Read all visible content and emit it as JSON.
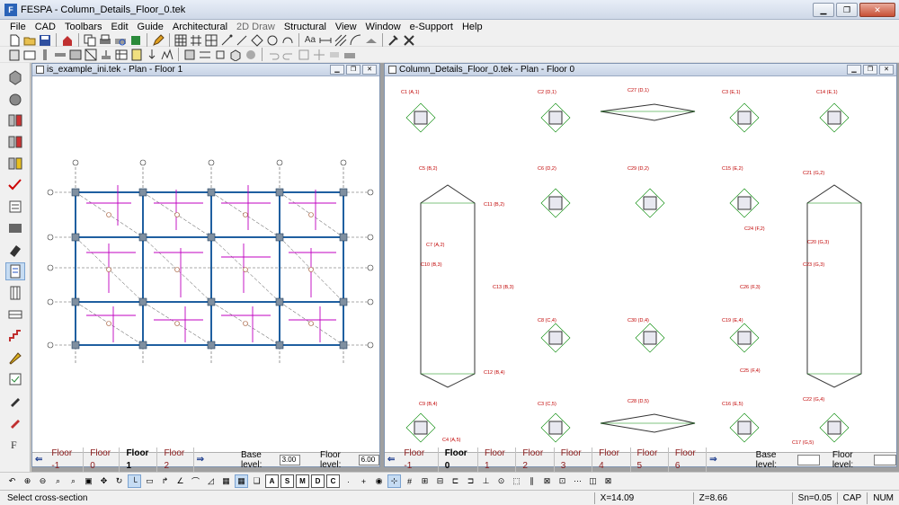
{
  "app": {
    "title": "FESPA - Column_Details_Floor_0.tek",
    "icon_label": "F"
  },
  "window_controls": [
    "minimize-icon",
    "maximize-icon",
    "close-icon"
  ],
  "menu": [
    {
      "label": "File",
      "enabled": true
    },
    {
      "label": "CAD",
      "enabled": true
    },
    {
      "label": "Toolbars",
      "enabled": true
    },
    {
      "label": "Edit",
      "enabled": true
    },
    {
      "label": "Guide",
      "enabled": true
    },
    {
      "label": "Architectural",
      "enabled": true
    },
    {
      "label": "2D Draw",
      "enabled": false
    },
    {
      "label": "Structural",
      "enabled": true
    },
    {
      "label": "View",
      "enabled": true
    },
    {
      "label": "Window",
      "enabled": true
    },
    {
      "label": "e-Support",
      "enabled": true
    },
    {
      "label": "Help",
      "enabled": true
    }
  ],
  "toolbar1": {
    "text_tool": "Aa"
  },
  "left_window": {
    "title": "is_example_ini.tek - Plan - Floor 1",
    "floors": [
      "Floor -1",
      "Floor 0",
      "Floor 1",
      "Floor 2"
    ],
    "active_floor": "Floor 1",
    "base_level_label": "Base level:",
    "base_level": "3.00",
    "floor_level_label": "Floor level:",
    "floor_level": "6.00"
  },
  "right_window": {
    "title": "Column_Details_Floor_0.tek - Plan - Floor 0",
    "floors": [
      "Floor -1",
      "Floor 0",
      "Floor 1",
      "Floor 2",
      "Floor 3",
      "Floor 4",
      "Floor 5",
      "Floor 6"
    ],
    "active_floor": "Floor 0",
    "base_level_label": "Base level:",
    "base_level": "",
    "floor_level_label": "Floor level:",
    "floor_level": "",
    "column_labels": [
      "C1 (A,1)",
      "C2 (D,1)",
      "C27 (D,1)",
      "C3 (E,1)",
      "C14 (E,1)",
      "C5 (B,2)",
      "C6 (D,2)",
      "C29 (D,2)",
      "C15 (E,2)",
      "C21 (G,2)",
      "C11 (B,2)",
      "C24 (F,2)",
      "C7 (A,2)",
      "C20 (G,3)",
      "C10 (B,3)",
      "C13 (B,3)",
      "C23 (G,3)",
      "C26 (F,3)",
      "C8 (C,4)",
      "C30 (D,4)",
      "C19 (E,4)",
      "C12 (B,4)",
      "C25 (F,4)",
      "C9 (B,4)",
      "C3 (C,5)",
      "C28 (D,5)",
      "C16 (E,5)",
      "C22 (G,4)",
      "C4 (A,5)",
      "C17 (G,5)"
    ]
  },
  "bottom_toolbar": {
    "letters": [
      "A",
      "S",
      "M",
      "D",
      "C"
    ]
  },
  "status": {
    "message": "Select cross-section",
    "x": "X=14.09",
    "z": "Z=8.66",
    "sn": "Sn=0.05",
    "caps": "CAP",
    "num": "NUM"
  },
  "colors": {
    "structure": "#1f5fa0",
    "beams": "#c000c0",
    "labels": "#c00000",
    "grid": "#444444",
    "rebar": "#008800"
  }
}
